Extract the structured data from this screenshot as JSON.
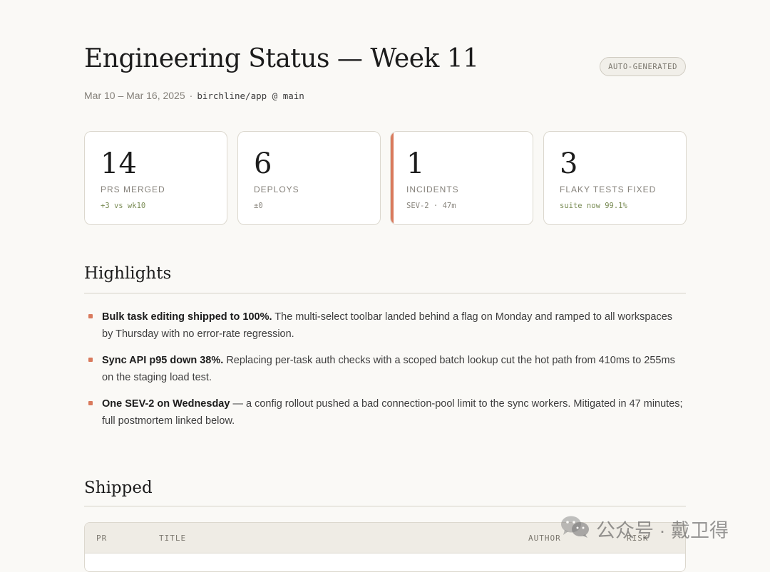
{
  "header": {
    "title": "Engineering Status — Week 11",
    "badge": "AUTO-GENERATED",
    "date_range": "Mar 10 – Mar 16, 2025",
    "separator": "·",
    "repo": "birchline/app @ main"
  },
  "stats": [
    {
      "value": "14",
      "label": "PRS MERGED",
      "note": "+3 vs wk10"
    },
    {
      "value": "6",
      "label": "DEPLOYS",
      "note": "±0"
    },
    {
      "value": "1",
      "label": "INCIDENTS",
      "note": "SEV-2 · 47m"
    },
    {
      "value": "3",
      "label": "FLAKY TESTS FIXED",
      "note": "suite now 99.1%"
    }
  ],
  "colors": {
    "accent": "#d97a5d",
    "positive_note": "#7a8c55",
    "background": "#faf9f6"
  },
  "highlights": {
    "heading": "Highlights",
    "items": [
      {
        "lead": "Bulk task editing shipped to 100%.",
        "text": " The multi-select toolbar landed behind a flag on Monday and ramped to all workspaces by Thursday with no error-rate regression."
      },
      {
        "lead": "Sync API p95 down 38%.",
        "text": " Replacing per-task auth checks with a scoped batch lookup cut the hot path from 410ms to 255ms on the staging load test."
      },
      {
        "lead": "One SEV-2 on Wednesday",
        "text": " — a config rollout pushed a bad connection-pool limit to the sync workers. Mitigated in 47 minutes; full postmortem linked below."
      }
    ]
  },
  "shipped": {
    "heading": "Shipped",
    "columns": [
      "PR",
      "TITLE",
      "AUTHOR",
      "RISK"
    ]
  },
  "watermark": {
    "text": "公众号 · 戴卫得",
    "icon": "wechat-icon"
  }
}
